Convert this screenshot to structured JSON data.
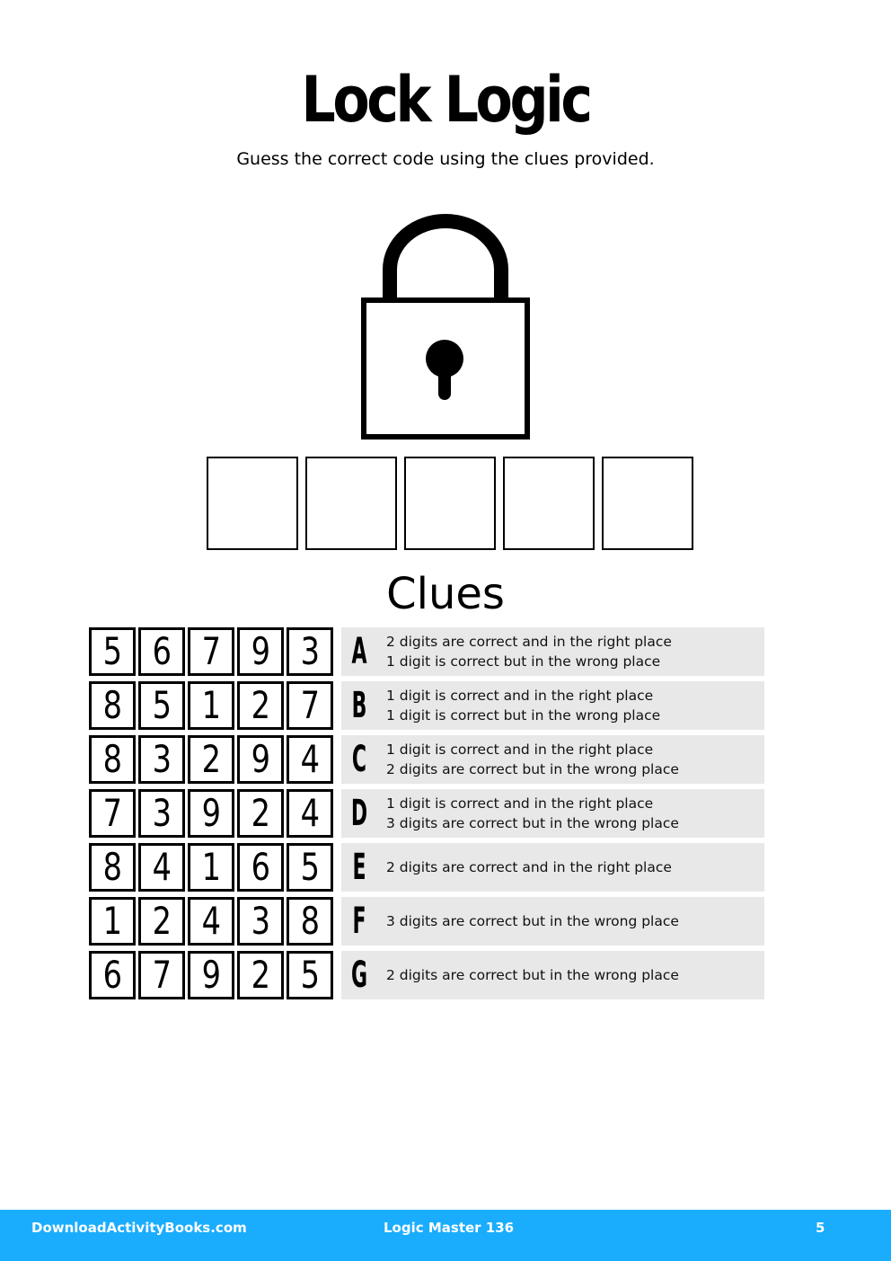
{
  "header": {
    "title": "Lock Logic",
    "subtitle": "Guess the correct code using the clues provided."
  },
  "puzzle": {
    "lock_icon": "padlock-icon",
    "code_length": 5,
    "code_boxes": [
      "",
      "",
      "",
      "",
      ""
    ],
    "clues_heading": "Clues",
    "clues": [
      {
        "letter": "A",
        "digits": [
          "5",
          "6",
          "7",
          "9",
          "3"
        ],
        "lines": [
          "2 digits are correct and in the right place",
          "1 digit is correct but in the wrong place"
        ]
      },
      {
        "letter": "B",
        "digits": [
          "8",
          "5",
          "1",
          "2",
          "7"
        ],
        "lines": [
          "1 digit is correct and in the right place",
          "1 digit is correct but in the wrong place"
        ]
      },
      {
        "letter": "C",
        "digits": [
          "8",
          "3",
          "2",
          "9",
          "4"
        ],
        "lines": [
          "1 digit is correct and in the right place",
          "2 digits are correct but in the wrong place"
        ]
      },
      {
        "letter": "D",
        "digits": [
          "7",
          "3",
          "9",
          "2",
          "4"
        ],
        "lines": [
          "1 digit is correct and in the right place",
          "3 digits are correct but in the wrong place"
        ]
      },
      {
        "letter": "E",
        "digits": [
          "8",
          "4",
          "1",
          "6",
          "5"
        ],
        "lines": [
          "2 digits are correct and in the right place"
        ]
      },
      {
        "letter": "F",
        "digits": [
          "1",
          "2",
          "4",
          "3",
          "8"
        ],
        "lines": [
          "3 digits are correct but in the wrong place"
        ]
      },
      {
        "letter": "G",
        "digits": [
          "6",
          "7",
          "9",
          "2",
          "5"
        ],
        "lines": [
          "2 digits are correct but in the wrong place"
        ]
      }
    ]
  },
  "footer": {
    "site": "DownloadActivityBooks.com",
    "book": "Logic Master 136",
    "page": "5",
    "color": "#1aadfd"
  }
}
